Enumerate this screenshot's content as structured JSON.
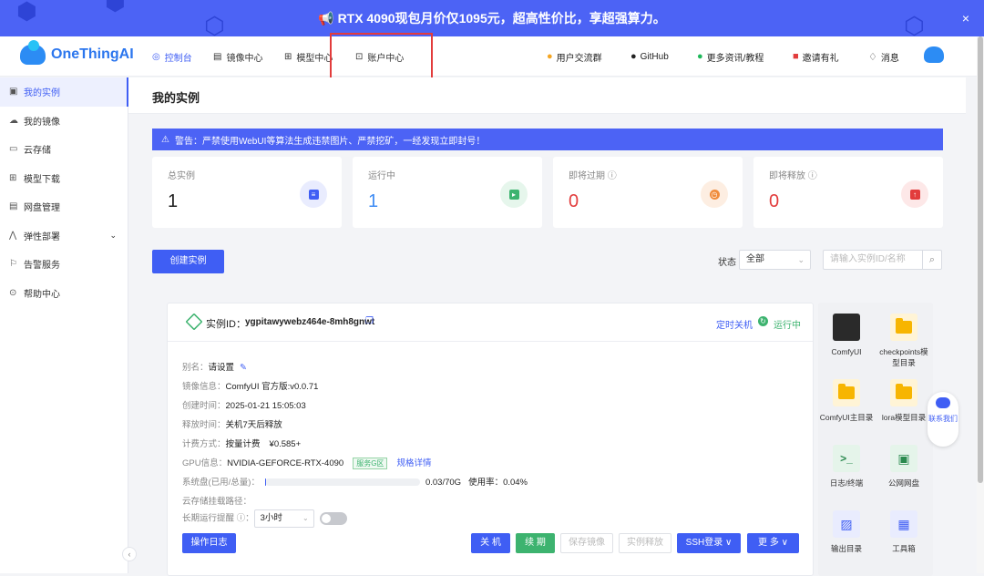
{
  "banner": {
    "text": "RTX 4090现包月价仅1095元，超高性价比，享超强算力。",
    "close": "×",
    "icon": "megaphone-icon"
  },
  "brand": {
    "name": "OneThingAI"
  },
  "nav": {
    "console": "控制台",
    "images": "镜像中心",
    "models": "模型中心",
    "account": "账户中心"
  },
  "top_right": {
    "community": "用户交流群",
    "github": "GitHub",
    "more": "更多资讯/教程",
    "invite": "邀请有礼",
    "messages": "消息"
  },
  "sidebar": {
    "items": [
      {
        "label": "我的实例",
        "icon": "instance-icon"
      },
      {
        "label": "我的镜像",
        "icon": "image-icon"
      },
      {
        "label": "云存储",
        "icon": "folder-icon"
      },
      {
        "label": "模型下载",
        "icon": "model-icon"
      },
      {
        "label": "网盘管理",
        "icon": "disk-icon"
      },
      {
        "label": "弹性部署",
        "icon": "deploy-icon"
      },
      {
        "label": "告警服务",
        "icon": "alarm-icon"
      },
      {
        "label": "帮助中心",
        "icon": "help-icon"
      }
    ],
    "collapse": "‹"
  },
  "page": {
    "title": "我的实例"
  },
  "warning": "警告：严禁使用WebUI等算法生成违禁图片、严禁挖矿，一经发现立即封号！",
  "stats": [
    {
      "label": "总实例",
      "value": "1",
      "color": "#3f5ef4"
    },
    {
      "label": "运行中",
      "value": "1",
      "color": "#3db36f"
    },
    {
      "label": "即将过期 ⓘ",
      "value": "0",
      "color": "#f08c3c"
    },
    {
      "label": "即将释放 ⓘ",
      "value": "0",
      "color": "#e23c3c"
    }
  ],
  "toolbar": {
    "create": "创建实例",
    "state_label": "状态",
    "state_value": "全部",
    "search_placeholder": "请输入实例ID/名称"
  },
  "instance": {
    "id_label": "实例ID：",
    "id": "ygpitawywebz464e-8mh8gnwt",
    "timer": "定时关机",
    "status": "运行中",
    "alias_label": "别名：",
    "alias": "请设置",
    "image_label": "镜像信息：",
    "image": "ComfyUI 官方版:v0.0.71",
    "created_label": "创建时间：",
    "created": "2025-01-21 15:05:03",
    "release_label": "释放时间：",
    "release": "关机7天后释放",
    "billing_label": "计费方式：",
    "billing": "按量计费",
    "price": "¥0.585+",
    "gpu_label": "GPU信息：",
    "gpu": "NVIDIA-GEFORCE-RTX-4090",
    "zone": "服务G区",
    "spec": "规格详情",
    "disk_label": "系统盘(已用/总量)：",
    "disk_used": "0.03/70G",
    "disk_usage": "使用率：0.04%",
    "disk_fraction": 0.0004,
    "mount_label": "云存储挂载路径：",
    "reminder_label": "长期运行提醒 ⓘ：",
    "reminder_value": "3小时"
  },
  "actions": {
    "log": "操作日志",
    "shutdown": "关 机",
    "renew": "续 期",
    "save_image": "保存镜像",
    "release": "实例释放",
    "ssh": "SSH登录 ∨",
    "more": "更 多 ∨"
  },
  "apps": [
    {
      "label": "ComfyUI"
    },
    {
      "label": "checkpoints模型目录"
    },
    {
      "label": "ComfyUI主目录"
    },
    {
      "label": "lora模型目录"
    },
    {
      "label": "日志/终端"
    },
    {
      "label": "公网网盘"
    },
    {
      "label": "输出目录"
    },
    {
      "label": "工具箱"
    }
  ],
  "contact": "联系我们"
}
